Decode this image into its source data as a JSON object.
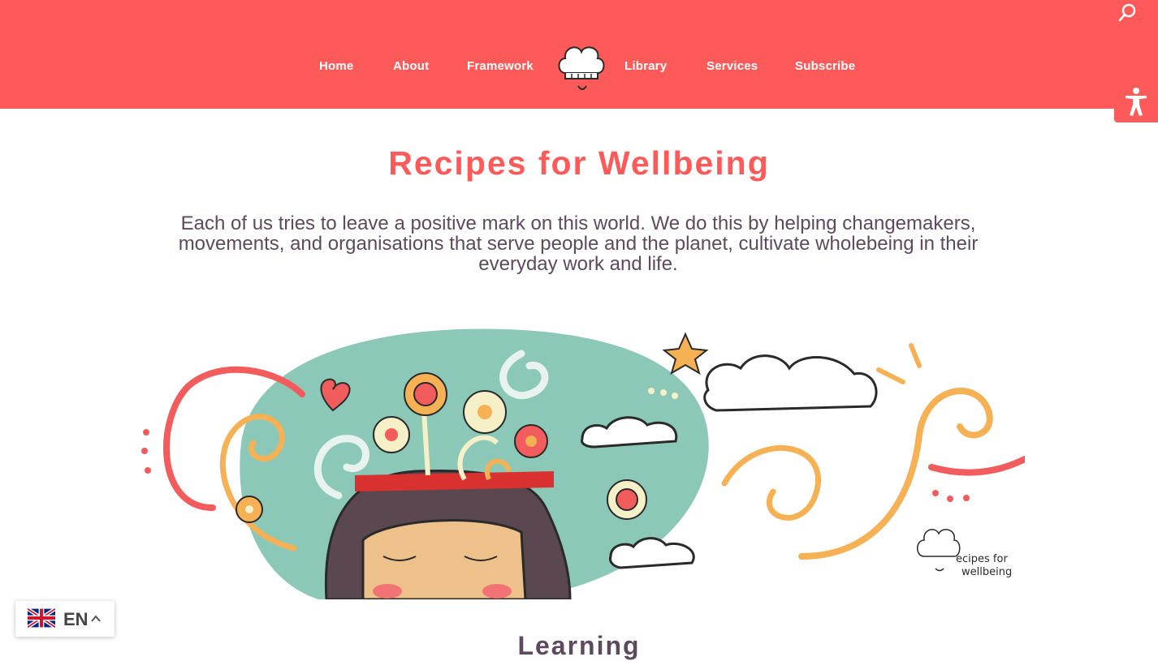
{
  "nav": {
    "items": [
      {
        "key": "home",
        "label": "Home"
      },
      {
        "key": "about",
        "label": "About"
      },
      {
        "key": "framework",
        "label": "Framework"
      },
      {
        "key": "library",
        "label": "Library"
      },
      {
        "key": "services",
        "label": "Services"
      },
      {
        "key": "subscribe",
        "label": "Subscribe"
      }
    ],
    "logo_icon": "chef-hat-logo-icon",
    "search_icon": "search-icon",
    "accessibility_icon": "accessibility-person-icon"
  },
  "main": {
    "title": "Recipes for Wellbeing",
    "intro": "Each of us tries to leave a positive mark on this world. We do this by helping changemakers, movements, and organisations that serve people and the planet, cultivate wholebeing in their everyday work and life.",
    "next_section_heading": "Learning"
  },
  "hero": {
    "watermark_line1": "ecipes for",
    "watermark_line2": "wellbeing"
  },
  "language": {
    "code": "EN",
    "flag_icon": "uk-flag-icon",
    "caret_icon": "chevron-up-icon"
  },
  "colors": {
    "brand": "#ff5a5a",
    "text": "#5e4a5c",
    "teal": "#8cc8b8",
    "orange": "#f7b155"
  }
}
